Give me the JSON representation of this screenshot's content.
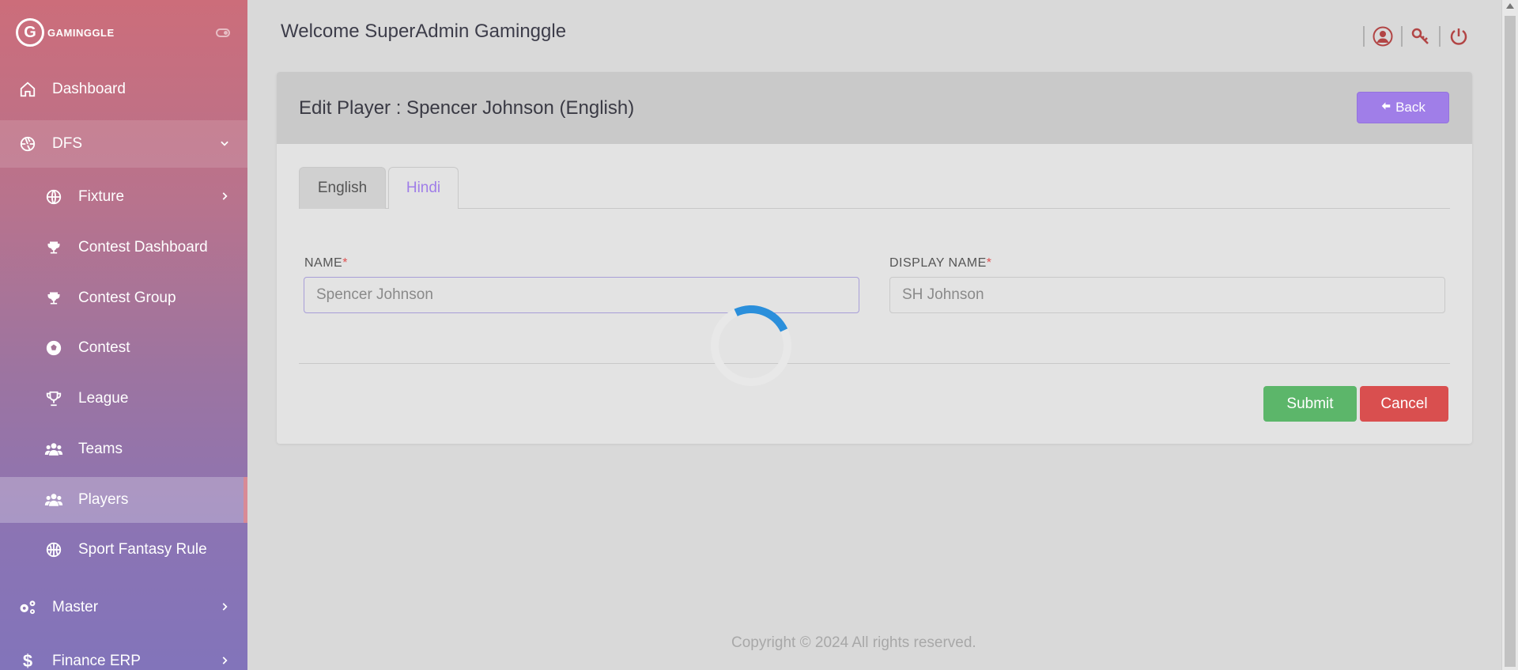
{
  "brand": {
    "logo_letter": "G",
    "name": "GAMINGGLE"
  },
  "sidebar": {
    "items": [
      {
        "label": "Dashboard",
        "icon": "home-icon"
      },
      {
        "label": "DFS",
        "icon": "aperture-icon"
      },
      {
        "label": "Fixture",
        "icon": "globe-icon"
      },
      {
        "label": "Contest Dashboard",
        "icon": "trophy-icon"
      },
      {
        "label": "Contest Group",
        "icon": "trophy-icon"
      },
      {
        "label": "Contest",
        "icon": "soccer-ball-icon"
      },
      {
        "label": "League",
        "icon": "trophy-outline-icon"
      },
      {
        "label": "Teams",
        "icon": "users-icon"
      },
      {
        "label": "Players",
        "icon": "users-icon"
      },
      {
        "label": "Sport Fantasy Rule",
        "icon": "basketball-icon"
      },
      {
        "label": "Master",
        "icon": "gears-icon"
      },
      {
        "label": "Finance ERP",
        "icon": "dollar-icon"
      }
    ]
  },
  "header": {
    "welcome": "Welcome SuperAdmin Gaminggle"
  },
  "card": {
    "title": "Edit Player : Spencer Johnson (English)",
    "back_label": "Back",
    "tabs": [
      {
        "label": "English"
      },
      {
        "label": "Hindi"
      }
    ],
    "name_label": "NAME",
    "name_value": "Spencer Johnson",
    "display_name_label": "DISPLAY NAME",
    "display_name_value": "SH Johnson",
    "required_mark": "*",
    "submit_label": "Submit",
    "cancel_label": "Cancel"
  },
  "footer": {
    "copyright": "Copyright © 2024  All rights reserved."
  },
  "colors": {
    "accent": "#a07ee8",
    "submit": "#5cb66a",
    "cancel": "#d94f4f",
    "spinner": "#2b8fdb"
  }
}
